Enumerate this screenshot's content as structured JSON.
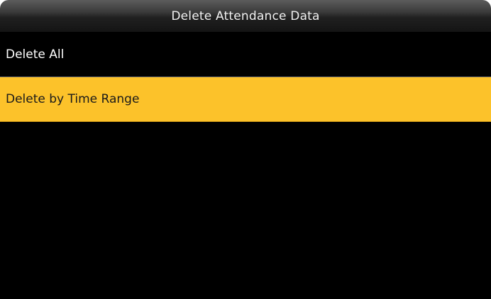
{
  "header": {
    "title": "Delete Attendance Data"
  },
  "menu": {
    "items": [
      {
        "label": "Delete All",
        "selected": false
      },
      {
        "label": "Delete by Time Range",
        "selected": true
      }
    ]
  },
  "colors": {
    "background": "#000000",
    "selected_highlight": "#fcc22a",
    "title_text": "#f2f2f2"
  }
}
